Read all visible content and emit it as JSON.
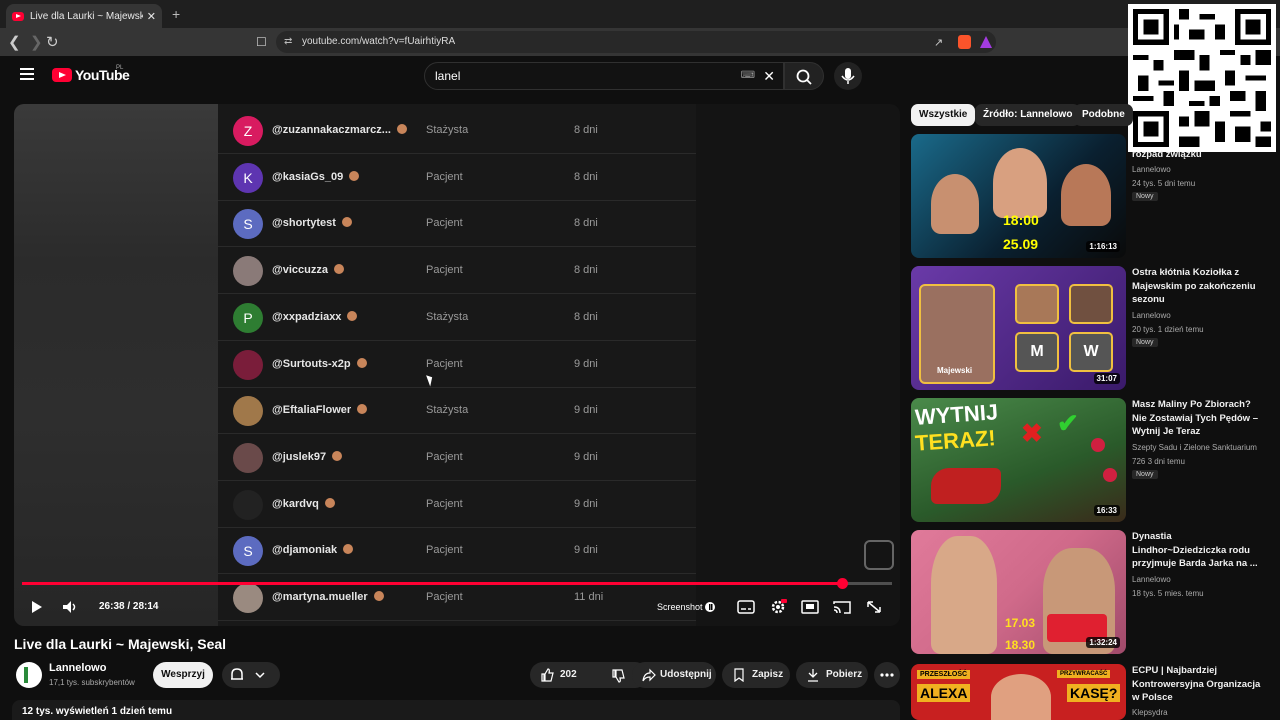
{
  "browser": {
    "tab_title": "Live dla Laurki ~ Majewski, Seal",
    "tab_close": "✕",
    "new_tab": "+",
    "url": "youtube.com/watch?v=fUairhtiyRA"
  },
  "header": {
    "logo_text": "YouTube",
    "logo_region": "PL",
    "search_value": "lanel"
  },
  "list_rows": [
    {
      "initial": "Z",
      "color": "#d81b60",
      "name": "@zuzannakaczmarcz...",
      "role": "Stażysta",
      "age": "8 dni"
    },
    {
      "initial": "K",
      "color": "#5e35b1",
      "name": "@kasiaGs_09",
      "role": "Pacjent",
      "age": "8 dni"
    },
    {
      "initial": "S",
      "color": "#5c6bc0",
      "name": "@shortytest",
      "role": "Pacjent",
      "age": "8 dni"
    },
    {
      "initial": "",
      "color": "#8a7a78",
      "name": "@viccuzza",
      "role": "Pacjent",
      "age": "8 dni"
    },
    {
      "initial": "P",
      "color": "#2e7d32",
      "name": "@xxpadziaxx",
      "role": "Stażysta",
      "age": "8 dni"
    },
    {
      "initial": "",
      "color": "#7a1d3a",
      "name": "@Surtouts-x2p",
      "role": "Pacjent",
      "age": "9 dni"
    },
    {
      "initial": "",
      "color": "#a0784a",
      "name": "@EftaliaFlower",
      "role": "Stażysta",
      "age": "9 dni"
    },
    {
      "initial": "",
      "color": "#6a4a4a",
      "name": "@juslek97",
      "role": "Pacjent",
      "age": "9 dni"
    },
    {
      "initial": "",
      "color": "#222222",
      "name": "@kardvq",
      "role": "Pacjent",
      "age": "9 dni"
    },
    {
      "initial": "S",
      "color": "#5c6bc0",
      "name": "@djamoniak",
      "role": "Pacjent",
      "age": "9 dni"
    },
    {
      "initial": "",
      "color": "#9a8a80",
      "name": "@martyna.mueller",
      "role": "Pacjent",
      "age": "11 dni"
    }
  ],
  "player": {
    "time": "26:38 / 28:14",
    "progress_fraction": 0.943,
    "screenshot_label": "Screenshot"
  },
  "video": {
    "title": "Live dla Laurki ~ Majewski, Seal",
    "channel": "Lannelowo",
    "subscribers": "17,1 tys. subskrybentów",
    "support": "Wesprzyj",
    "likes": "202",
    "share": "Udostępnij",
    "save": "Zapisz",
    "download": "Pobierz",
    "stats": "12 tys. wyświetleń  1 dzień temu"
  },
  "chips": [
    "Wszystkie",
    "Źródło: Lannelowo",
    "Podobne"
  ],
  "recommendations": [
    {
      "title": "rozpad związku",
      "channel": "Lannelowo",
      "meta": "24 tys.  5 dni temu",
      "new": "Nowy",
      "duration": "1:16:13",
      "thumb": [
        "#1a6a8a",
        "#0a0a0a"
      ]
    },
    {
      "title": "Ostra kłótnia Koziołka z Majewskim po zakończeniu sezonu",
      "channel": "Lannelowo",
      "meta": "20 tys.  1 dzień temu",
      "new": "Nowy",
      "duration": "31:07",
      "thumb": [
        "#6a3aa8",
        "#2a1a4a"
      ]
    },
    {
      "title": "Masz Maliny Po Zbiorach? Nie Zostawiaj Tych Pędów – Wytnij Je Teraz",
      "channel": "Szepty Sadu i Zielone Sanktuarium",
      "meta": "726  3 dni temu",
      "new": "Nowy",
      "duration": "16:33",
      "thumb": [
        "#3a7a3a",
        "#a02020"
      ]
    },
    {
      "title": "Dynastia Lindhor~Dziedziczka rodu przyjmuje Barda Jarka na ...",
      "channel": "Lannelowo",
      "meta": "18 tys.  5 mies. temu",
      "new": "",
      "duration": "1:32:24",
      "thumb": [
        "#d06a8a",
        "#6a4a3a"
      ]
    },
    {
      "title": "ECPU | Najbardziej Kontrowersyjna Organizacja w Polsce",
      "channel": "Klepsydra",
      "meta": "",
      "new": "",
      "duration": "",
      "thumb": [
        "#e0a020",
        "#b02020"
      ]
    }
  ],
  "thumb_texts": {
    "r1_a": "18:00",
    "r1_b": "25.09",
    "r2_name": "Majewski",
    "r2_m": "M",
    "r2_w": "W",
    "r3_a": "WYTNIJ",
    "r3_b": "TERAZ!",
    "r4_a": "17.03",
    "r4_b": "18.30",
    "r5_a": "PRZESZŁOŚĆ",
    "r5_b": "ALEXA",
    "r5_c": "PRZYWRACAŚĆ",
    "r5_d": "KASĘ?"
  }
}
